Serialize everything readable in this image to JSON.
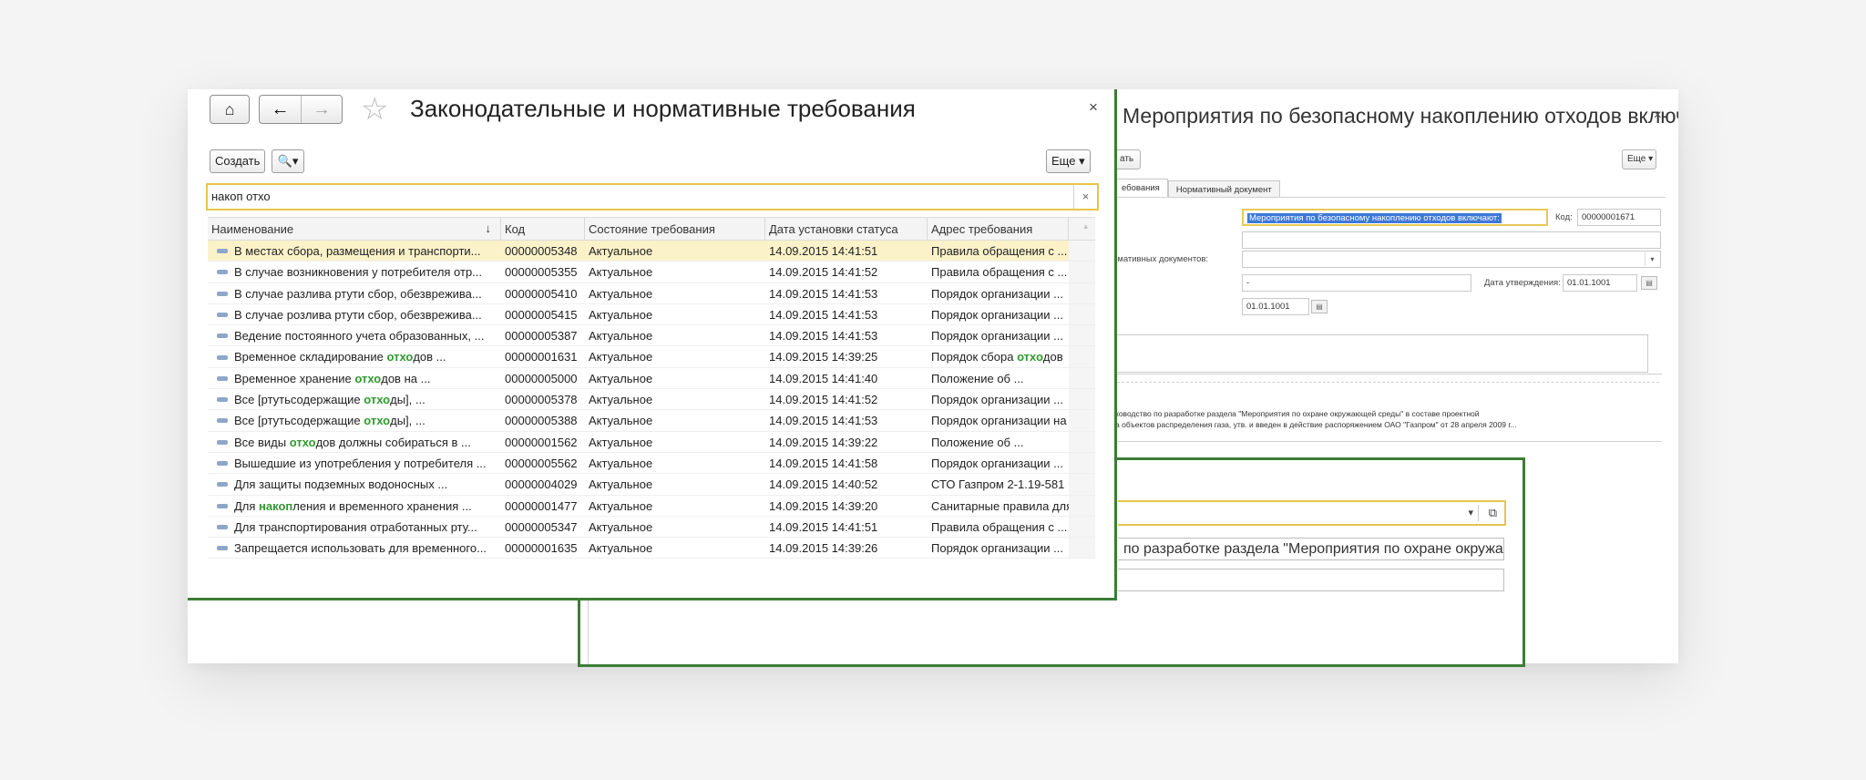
{
  "main_window": {
    "title": "Законодательные и нормативные требования",
    "close_label": "×",
    "create_label": "Создать",
    "search_button_label": "🔍▾",
    "more_label": "Еще ▾",
    "search_value": "накоп отхо",
    "search_clear_label": "×",
    "columns": [
      "Наименование",
      "Код",
      "Состояние требования",
      "Дата установки статуса",
      "Адрес требования"
    ],
    "sort_indicator": "↓",
    "rows": [
      {
        "pre": "В местах сбора, размещения и транспорти...",
        "hl": "",
        "post": "",
        "code": "00000005348",
        "state": "Актуальное",
        "date": "14.09.2015 14:41:51",
        "addr_pre": "Правила обращения с ...",
        "addr_hl": "",
        "addr_post": "",
        "selected": true
      },
      {
        "pre": "В случае возникновения у потребителя отр...",
        "hl": "",
        "post": "",
        "code": "00000005355",
        "state": "Актуальное",
        "date": "14.09.2015 14:41:52",
        "addr_pre": "Правила обращения с ...",
        "addr_hl": "",
        "addr_post": ""
      },
      {
        "pre": "В случае разлива ртути сбор, обезврежива...",
        "hl": "",
        "post": "",
        "code": "00000005410",
        "state": "Актуальное",
        "date": "14.09.2015 14:41:53",
        "addr_pre": "Порядок организации ...",
        "addr_hl": "",
        "addr_post": ""
      },
      {
        "pre": "В случае розлива ртути сбор, обезврежива...",
        "hl": "",
        "post": "",
        "code": "00000005415",
        "state": "Актуальное",
        "date": "14.09.2015 14:41:53",
        "addr_pre": "Порядок организации ...",
        "addr_hl": "",
        "addr_post": ""
      },
      {
        "pre": "Ведение постоянного учета образованных, ...",
        "hl": "",
        "post": "",
        "code": "00000005387",
        "state": "Актуальное",
        "date": "14.09.2015 14:41:53",
        "addr_pre": "Порядок организации ...",
        "addr_hl": "",
        "addr_post": ""
      },
      {
        "pre": "Временное складирование ",
        "hl": "отхо",
        "post": "дов ...",
        "code": "00000001631",
        "state": "Актуальное",
        "date": "14.09.2015 14:39:25",
        "addr_pre": "Порядок сбора ",
        "addr_hl": "отхо",
        "addr_post": "дов"
      },
      {
        "pre": "Временное хранение ",
        "hl": "отхо",
        "post": "дов на ...",
        "code": "00000005000",
        "state": "Актуальное",
        "date": "14.09.2015 14:41:40",
        "addr_pre": "Положение об ...",
        "addr_hl": "",
        "addr_post": ""
      },
      {
        "pre": "Все [ртутьсодержащие ",
        "hl": "отхо",
        "post": "ды], ...",
        "code": "00000005378",
        "state": "Актуальное",
        "date": "14.09.2015 14:41:52",
        "addr_pre": "Порядок организации ...",
        "addr_hl": "",
        "addr_post": ""
      },
      {
        "pre": "Все [ртутьсодержащие ",
        "hl": "отхо",
        "post": "ды], ...",
        "code": "00000005388",
        "state": "Актуальное",
        "date": "14.09.2015 14:41:53",
        "addr_pre": "Порядок организации на",
        "addr_hl": "",
        "addr_post": ""
      },
      {
        "pre": "Все виды ",
        "hl": "отхо",
        "post": "дов должны собираться в ...",
        "code": "00000001562",
        "state": "Актуальное",
        "date": "14.09.2015 14:39:22",
        "addr_pre": "Положение об ...",
        "addr_hl": "",
        "addr_post": ""
      },
      {
        "pre": "Вышедшие из употребления у потребителя ...",
        "hl": "",
        "post": "",
        "code": "00000005562",
        "state": "Актуальное",
        "date": "14.09.2015 14:41:58",
        "addr_pre": "Порядок организации ...",
        "addr_hl": "",
        "addr_post": ""
      },
      {
        "pre": "Для защиты подземных водоносных ...",
        "hl": "",
        "post": "",
        "code": "00000004029",
        "state": "Актуальное",
        "date": "14.09.2015 14:40:52",
        "addr_pre": "СТО Газпром 2-1.19-581",
        "addr_hl": "",
        "addr_post": ""
      },
      {
        "pre": "Для ",
        "hl": "накоп",
        "post": "ления и временного хранения ...",
        "code": "00000001477",
        "state": "Актуальное",
        "date": "14.09.2015 14:39:20",
        "addr_pre": "Санитарные правила для",
        "addr_hl": "",
        "addr_post": ""
      },
      {
        "pre": "Для транспортирования отработанных рту...",
        "hl": "",
        "post": "",
        "code": "00000005347",
        "state": "Актуальное",
        "date": "14.09.2015 14:41:51",
        "addr_pre": "Правила обращения с ...",
        "addr_hl": "",
        "addr_post": ""
      },
      {
        "pre": "Запрещается использовать для временного...",
        "hl": "",
        "post": "",
        "code": "00000001635",
        "state": "Актуальное",
        "date": "14.09.2015 14:39:26",
        "addr_pre": "Порядок организации ...",
        "addr_hl": "",
        "addr_post": ""
      }
    ]
  },
  "right_window": {
    "title": "Мероприятия по безопасному накоплению отходов включа...",
    "close_label": "×",
    "create_label_partial": "ать",
    "more_label": "Еще ▾",
    "tabs": [
      "ебования",
      "Нормативный документ"
    ],
    "name_value": "Мероприятия по безопасному накоплению отходов включают:",
    "code_label": "Код:",
    "code_value": "00000001671",
    "docs_label": "рмативных документов:",
    "dash_value": "-",
    "approval_label": "Дата утверждения:",
    "approval_date": "01.01.1001",
    "date_value": "01.01.1001",
    "note_line1": "ководство по разработке раздела \"Мероприятия по охране окружающей среды\" в составе проектной",
    "note_line2": "а объектов распределения газа, утв. и введен в действие распоряжением ОАО \"Газпром\" от 28 апреля 2009 г..."
  },
  "lower_window": {
    "text_value": "по разработке раздела \"Мероприятия по охране окружающей с"
  },
  "colors": {
    "accent_green": "#3c7d36",
    "highlight_green": "#2f9a2f",
    "search_border": "#e7c64b",
    "selected_row": "#fbf2c9"
  }
}
